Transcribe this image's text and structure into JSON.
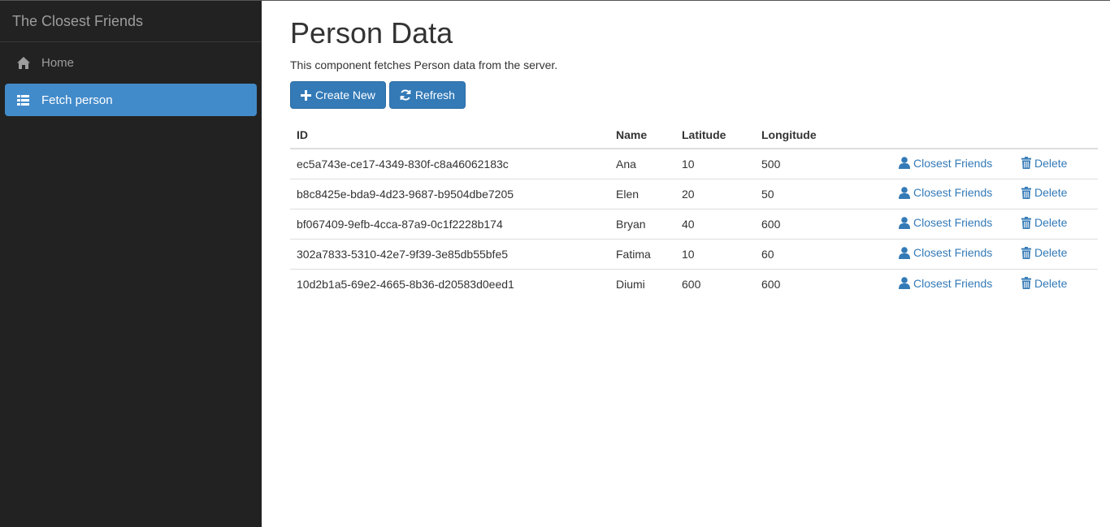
{
  "sidebar": {
    "brand": "The Closest Friends",
    "items": [
      {
        "label": "Home",
        "icon": "home-icon",
        "active": false
      },
      {
        "label": "Fetch person",
        "icon": "th-list-icon",
        "active": true
      }
    ]
  },
  "main": {
    "title": "Person Data",
    "subtitle": "This component fetches Person data from the server.",
    "create_label": "Create New",
    "refresh_label": "Refresh"
  },
  "table": {
    "headers": [
      "ID",
      "Name",
      "Latitude",
      "Longitude"
    ],
    "action_friends": "Closest Friends",
    "action_delete": "Delete",
    "rows": [
      {
        "id": "ec5a743e-ce17-4349-830f-c8a46062183c",
        "name": "Ana",
        "latitude": "10",
        "longitude": "500"
      },
      {
        "id": "b8c8425e-bda9-4d23-9687-b9504dbe7205",
        "name": "Elen",
        "latitude": "20",
        "longitude": "50"
      },
      {
        "id": "bf067409-9efb-4cca-87a9-0c1f2228b174",
        "name": "Bryan",
        "latitude": "40",
        "longitude": "600"
      },
      {
        "id": "302a7833-5310-42e7-9f39-3e85db55bfe5",
        "name": "Fatima",
        "latitude": "10",
        "longitude": "60"
      },
      {
        "id": "10d2b1a5-69e2-4665-8b36-d20583d0eed1",
        "name": "Diumi",
        "latitude": "600",
        "longitude": "600"
      }
    ]
  },
  "colors": {
    "sidebar_bg": "#222222",
    "active_item": "#428bca",
    "primary_button": "#337ab7",
    "link": "#337ab7"
  }
}
